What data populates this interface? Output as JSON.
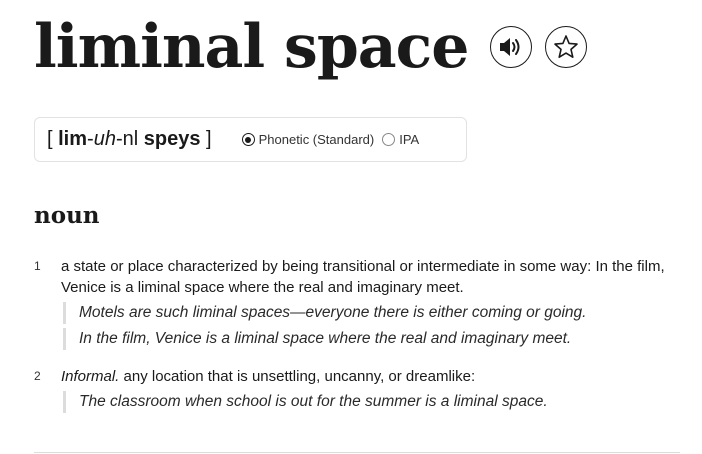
{
  "entry": {
    "headword": "liminal space",
    "audio_icon": "speaker-icon",
    "favorite_icon": "star-icon"
  },
  "pronunciation": {
    "open_bracket": "[",
    "part1": "lim",
    "hyphen1": "-",
    "part2": "uh",
    "hyphen2": "-",
    "part3": "nl",
    "part4": "speys",
    "close_bracket": "]",
    "options": [
      {
        "label": "Phonetic (Standard)",
        "selected": true
      },
      {
        "label": "IPA",
        "selected": false
      }
    ]
  },
  "part_of_speech": "noun",
  "senses": [
    {
      "number": "1",
      "definition": "a state or place characterized by being transitional or intermediate in some way: In the film, Venice is a liminal space where the real and imaginary meet.",
      "examples": [
        "Motels are such liminal spaces—everyone there is either coming or going.",
        "In the film, Venice is a liminal space where the real and imaginary meet."
      ]
    },
    {
      "number": "2",
      "label": "Informal.",
      "definition": "any location that is unsettling, uncanny, or dreamlike:",
      "examples": [
        "The classroom when school is out for the summer is a liminal space."
      ]
    }
  ]
}
